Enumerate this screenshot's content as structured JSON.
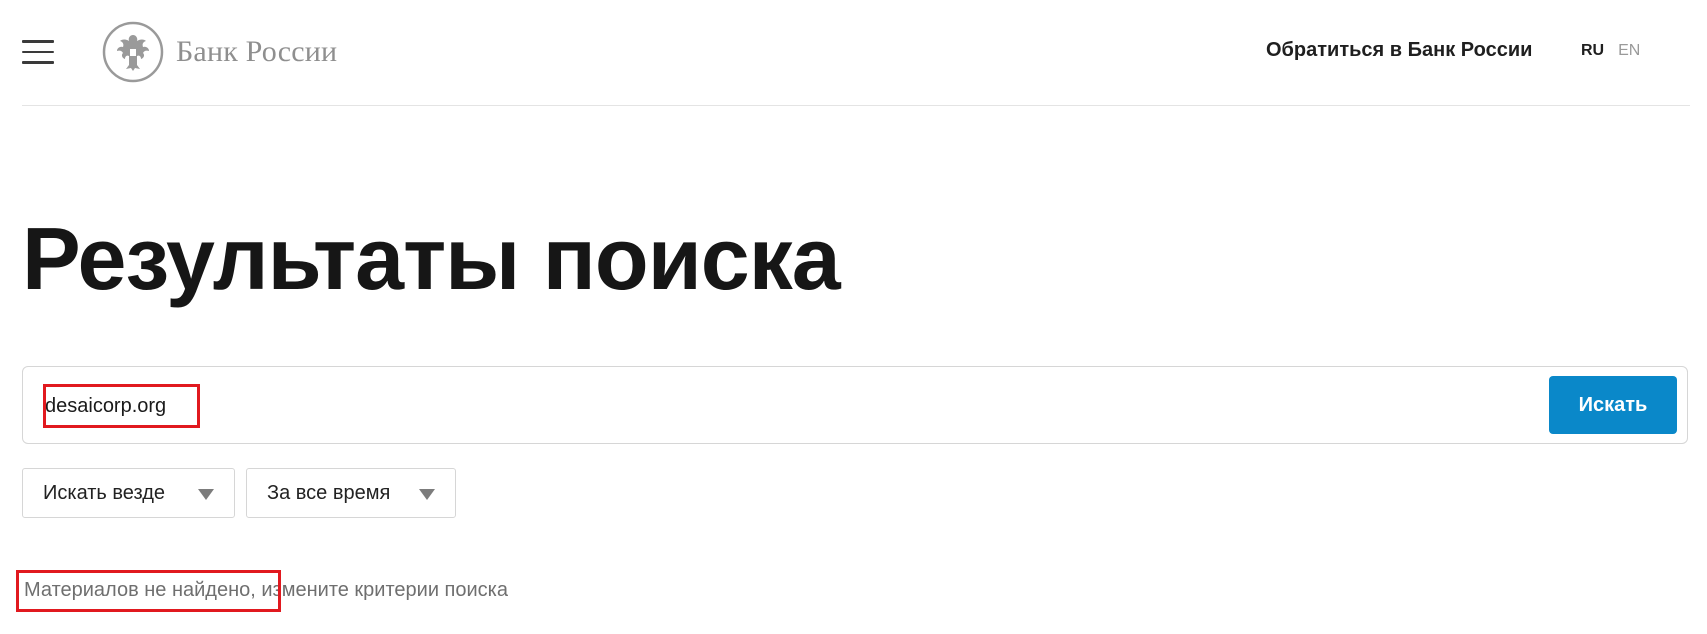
{
  "header": {
    "menu_icon": "hamburger-menu-icon",
    "logo_icon": "double-headed-eagle-emblem-icon",
    "logo_text": "Банк России",
    "contact_link": "Обратиться в Банк России",
    "lang_ru": "RU",
    "lang_en": "EN"
  },
  "main": {
    "title": "Результаты поиска",
    "search": {
      "value": "desaicorp.org",
      "button_label": "Искать"
    },
    "filters": [
      {
        "label": "Искать везде",
        "icon": "dropdown-triangle-icon"
      },
      {
        "label": "За все время",
        "icon": "dropdown-triangle-icon"
      }
    ],
    "results": {
      "message": "Материалов не найдено, измените критерии поиска"
    }
  },
  "colors": {
    "accent": "#0a88c9",
    "highlight": "#e1191f",
    "logo_gray": "#8f8f8f"
  }
}
